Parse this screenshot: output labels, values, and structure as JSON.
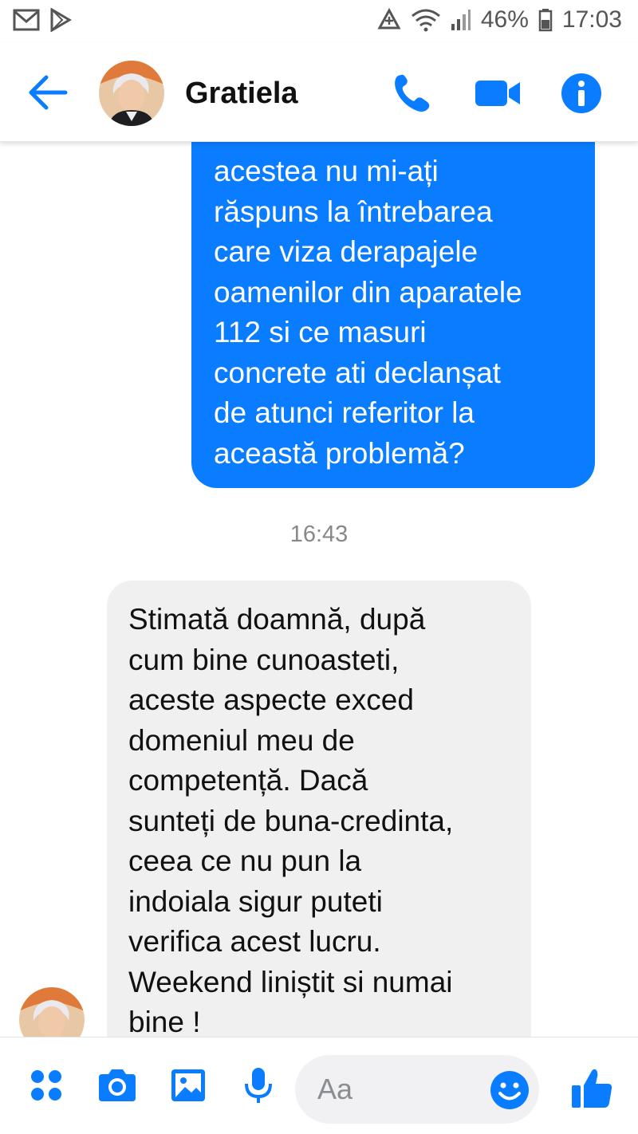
{
  "status_bar": {
    "battery": "46%",
    "time": "17:03",
    "left_icons": [
      "gmail-icon",
      "play-store-icon"
    ],
    "right_icons": [
      "data-saver-icon",
      "wifi-icon",
      "signal-icon",
      "battery-icon"
    ]
  },
  "header": {
    "contact_name": "Gratiela",
    "icons": [
      "back-arrow-icon",
      "phone-icon",
      "video-camera-icon",
      "info-icon"
    ]
  },
  "colors": {
    "accent": "#0a7cff",
    "outgoing_bubble": "#0a7cff",
    "incoming_bubble": "#f0f0f0"
  },
  "messages": {
    "outgoing": {
      "lines": [
        "acestea nu mi-ați",
        "răspuns la întrebarea",
        "care viza derapajele",
        "oamenilor din aparatele",
        "112 si ce masuri",
        "concrete ati declanșat",
        "de atunci referitor la",
        "această problemă?"
      ]
    },
    "timestamp": "16:43",
    "incoming": {
      "lines": [
        "Stimată doamnă, după",
        "cum bine cunoasteti,",
        "aceste aspecte exced",
        "domeniul meu de",
        "competență. Dacă",
        "sunteți de buna-credinta,",
        "ceea ce nu pun la",
        "indoiala sigur puteti",
        "verifica acest lucru.",
        "Weekend liniștit si numai",
        "bine !"
      ]
    }
  },
  "composer": {
    "placeholder": "Aa",
    "value": "",
    "icons": [
      "apps-icon",
      "camera-icon",
      "gallery-icon",
      "microphone-icon",
      "emoji-icon",
      "thumbs-up-icon"
    ]
  }
}
